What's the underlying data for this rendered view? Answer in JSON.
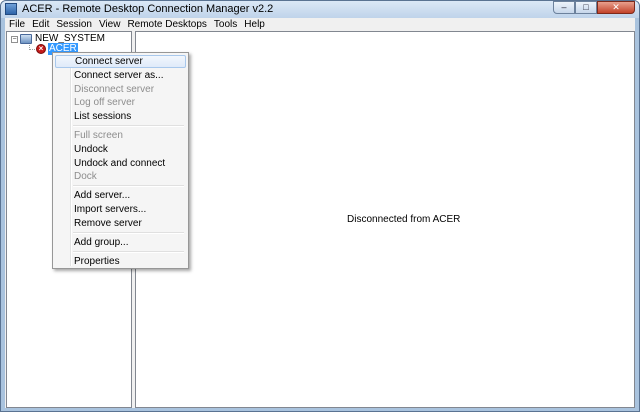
{
  "window": {
    "title": "ACER - Remote Desktop Connection Manager v2.2",
    "buttons": {
      "minimize": "–",
      "maximize": "□",
      "close": "✕"
    }
  },
  "menubar": {
    "items": [
      "File",
      "Edit",
      "Session",
      "View",
      "Remote Desktops",
      "Tools",
      "Help"
    ]
  },
  "tree": {
    "group": {
      "label": "NEW_SYSTEM",
      "expander": "−"
    },
    "server": {
      "label": "ACER",
      "status_glyph": "×"
    }
  },
  "content": {
    "status": "Disconnected from ACER"
  },
  "context_menu": {
    "items": [
      {
        "label": "Connect server",
        "enabled": true,
        "highlighted": true
      },
      {
        "label": "Connect server as...",
        "enabled": true
      },
      {
        "label": "Disconnect server",
        "enabled": false
      },
      {
        "label": "Log off server",
        "enabled": false
      },
      {
        "label": "List sessions",
        "enabled": true
      },
      {
        "label": "Full screen",
        "enabled": false
      },
      {
        "label": "Undock",
        "enabled": true
      },
      {
        "label": "Undock and connect",
        "enabled": true
      },
      {
        "label": "Dock",
        "enabled": false
      },
      {
        "label": "Add server...",
        "enabled": true
      },
      {
        "label": "Import servers...",
        "enabled": true
      },
      {
        "label": "Remove server",
        "enabled": true
      },
      {
        "label": "Add group...",
        "enabled": true
      },
      {
        "label": "Properties",
        "enabled": true
      }
    ]
  },
  "colors": {
    "selection": "#3399ff",
    "disabled_text": "#8d8d8d",
    "error_icon": "#c41a1a"
  }
}
